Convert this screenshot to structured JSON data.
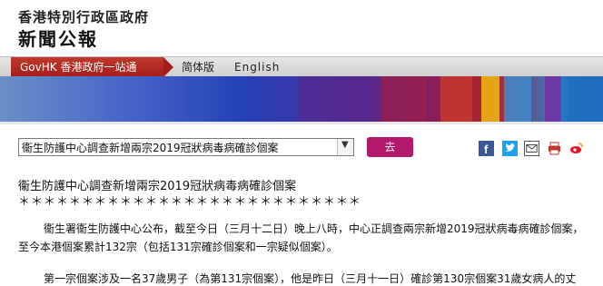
{
  "header": {
    "gov_title": "香港特別行政區政府",
    "site_title": "新聞公報"
  },
  "nav": {
    "govhk_label": "GovHK 香港政府一站通",
    "simplified_label": "简体版",
    "english_label": "English"
  },
  "selector": {
    "selected": "衞生防護中心調查新增兩宗2019冠狀病毒病確診個案",
    "go_label": "去"
  },
  "share": {
    "icons": [
      "facebook-icon",
      "twitter-icon",
      "email-icon",
      "print-icon",
      "weibo-icon"
    ]
  },
  "article": {
    "headline": "衞生防護中心調查新增兩宗2019冠狀病毒病確診個案",
    "stars": "＊＊＊＊＊＊＊＊＊＊＊＊＊＊＊＊＊＊＊＊＊＊＊＊＊＊＊",
    "para1": "衞生署衞生防護中心公布，截至今日（三月十二日）晚上八時，中心正調查兩宗新增2019冠狀病毒病確診個案，",
    "para2": "至今本港個案累計132宗（包括131宗確診個案和一宗疑似個案）。",
    "para3": "第一宗個案涉及一名37歲男子（為第131宗個案），他是昨日（三月十一日）確診第130宗個案31歲女病人的丈"
  },
  "colors": {
    "govhk_red": "#a31d1d",
    "go_button": "#b2196b"
  }
}
